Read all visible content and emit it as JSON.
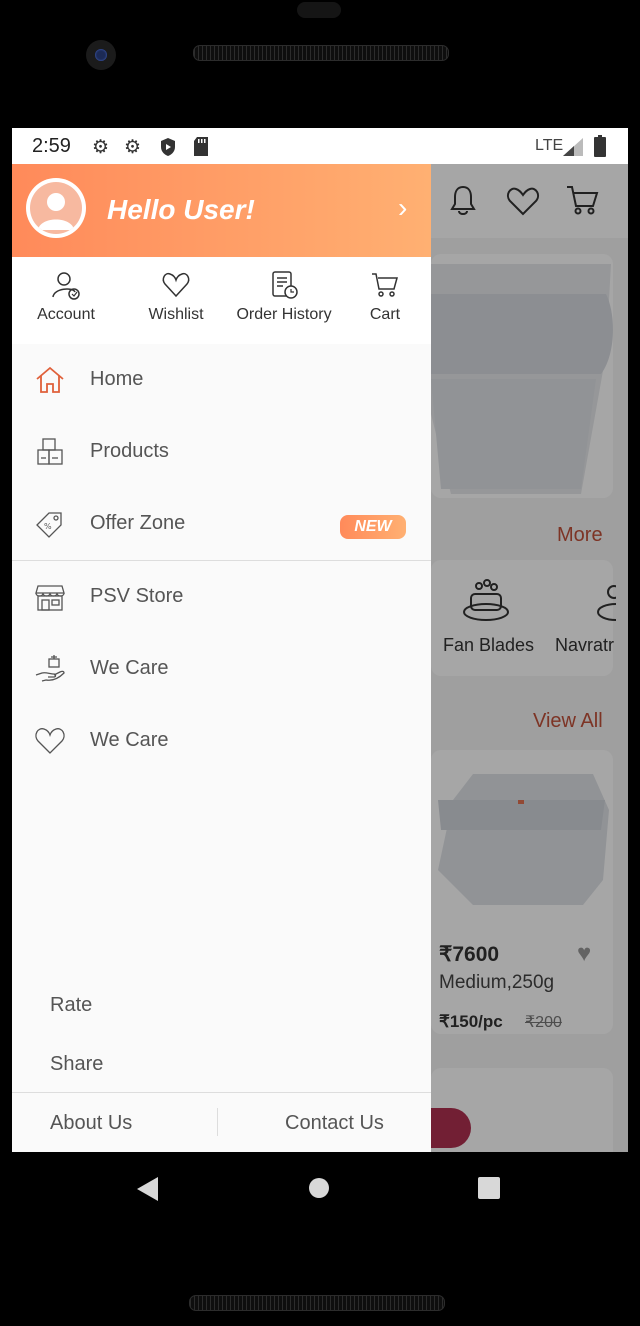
{
  "status_bar": {
    "time": "2:59",
    "network": "LTE"
  },
  "drawer": {
    "greeting": "Hello User!",
    "quick_actions": [
      {
        "label": "Account",
        "icon": "account-icon"
      },
      {
        "label": "Wishlist",
        "icon": "heart-icon"
      },
      {
        "label": "Order History",
        "icon": "order-history-icon"
      },
      {
        "label": "Cart",
        "icon": "cart-icon"
      }
    ],
    "menu": [
      {
        "label": "Home",
        "icon": "home-icon"
      },
      {
        "label": "Products",
        "icon": "products-icon"
      },
      {
        "label": "Offer Zone",
        "icon": "tag-icon",
        "badge": "NEW"
      },
      {
        "label": "PSV Store",
        "icon": "store-icon"
      },
      {
        "label": "We Care",
        "icon": "hand-icon"
      },
      {
        "label": "We Care",
        "icon": "heart-icon"
      }
    ],
    "rate": "Rate",
    "share": "Share",
    "about": "About Us",
    "contact": "Contact Us"
  },
  "background": {
    "more": "More",
    "view_all": "View All",
    "categories": [
      "Fan Blades",
      "Navratr"
    ],
    "product": {
      "price": "₹7600",
      "name": "Medium,250g",
      "unit_price": "₹150/pc",
      "old_price": "₹200"
    }
  },
  "colors": {
    "accent_start": "#ff8a5a",
    "accent_end": "#ffb072",
    "link": "#c0503a"
  }
}
